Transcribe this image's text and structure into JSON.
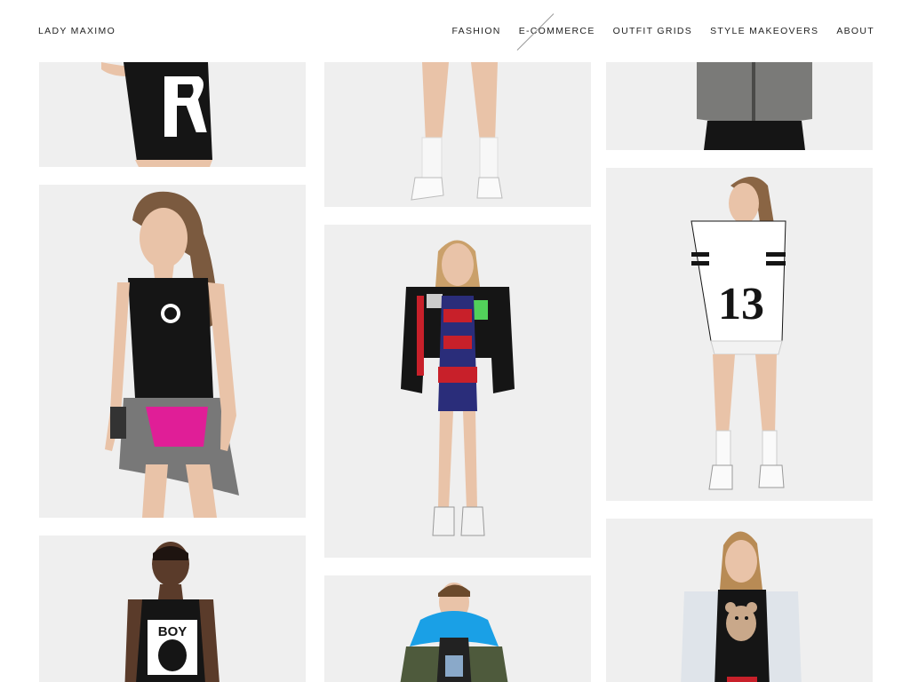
{
  "site": {
    "brand": "LADY MAXIMO"
  },
  "nav": {
    "items": [
      "FASHION",
      "E-COMMERCE",
      "OUTFIT GRIDS",
      "STYLE MAKEOVERS",
      "ABOUT"
    ],
    "active_index": 1
  },
  "gallery": {
    "tiles": [
      {
        "name": "tile-black-r-skirt"
      },
      {
        "name": "tile-legs-white-socks"
      },
      {
        "name": "tile-grey-zip-vest"
      },
      {
        "name": "tile-mesh-tank-dress"
      },
      {
        "name": "tile-bomber-jacket"
      },
      {
        "name": "tile-jersey-13",
        "print": "13"
      },
      {
        "name": "tile-boy-tank",
        "print": "BOY"
      },
      {
        "name": "tile-fur-hood-parka"
      },
      {
        "name": "tile-teddy-bear-jacket"
      }
    ]
  },
  "colors": {
    "tile_bg": "#efefef",
    "skin": "#e9c3a8",
    "black": "#151515",
    "accent_blue": "#1aa0e6",
    "accent_red": "#c8202a"
  }
}
